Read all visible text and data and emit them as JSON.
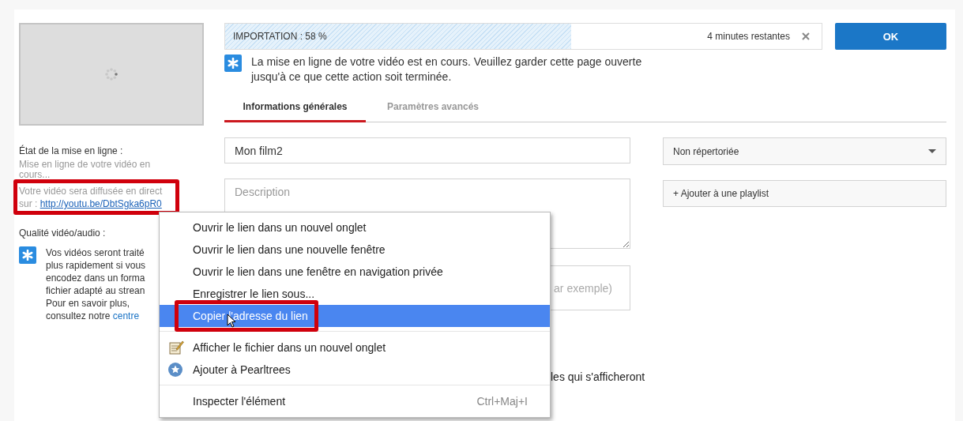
{
  "thumbnail": {
    "kind": "loading"
  },
  "status": {
    "heading": "État de la mise en ligne :",
    "text": "Mise en ligne de votre vidéo en cours...",
    "live_text": "Votre vidéo sera diffusée en direct",
    "link_prefix": "sur :",
    "link": "http://youtu.be/DbtSgka6pR0",
    "highlighted": true
  },
  "quality": {
    "heading": "Qualité vidéo/audio :",
    "lines": [
      "Vos vidéos seront traité",
      "plus rapidement si vous",
      "encodez dans un forma",
      "fichier adapté au strean",
      "Pour en savoir plus,"
    ],
    "last_line": "consultez notre",
    "link": "centre"
  },
  "upload": {
    "label": "IMPORTATION : 58 %",
    "level": 0.58,
    "remaining": "4 minutes restantes"
  },
  "ok_button": "OK",
  "notice": "La mise en ligne de votre vidéo est en cours. Veuillez garder cette page ouverte jusqu'à ce que cette action soit terminée.",
  "tabs": [
    {
      "label": "Informations générales",
      "selected": true
    },
    {
      "label": "Paramètres avancés",
      "selected": false
    }
  ],
  "form": {
    "title": {
      "value": "Mon film2"
    },
    "description": {
      "placeholder": "Description"
    },
    "tags": {
      "placeholder": "ar exemple)"
    },
    "note": "les qui s'afficheront"
  },
  "privacy": {
    "value": "Non répertoriée"
  },
  "playlist_button": "+ Ajouter à une playlist",
  "context_menu": [
    {
      "kind": "item",
      "label": "Ouvrir le lien dans un nouvel onglet",
      "selected": false
    },
    {
      "kind": "item",
      "label": "Ouvrir le lien dans une nouvelle fenêtre",
      "selected": false
    },
    {
      "kind": "item",
      "label": "Ouvrir le lien dans une fenêtre en navigation privée",
      "selected": false
    },
    {
      "kind": "item",
      "label": "Enregistrer le lien sous...",
      "selected": false
    },
    {
      "kind": "item",
      "label": "Copier l'adresse du lien",
      "selected": true,
      "highlighted": true
    },
    {
      "kind": "separator"
    },
    {
      "kind": "file",
      "label": "Afficher le fichier dans un nouvel onglet",
      "selected": false
    },
    {
      "kind": "pearltrees",
      "label": "Ajouter à Pearltrees",
      "selected": false
    },
    {
      "kind": "separator"
    },
    {
      "kind": "item",
      "label": "Inspecter l'élément",
      "shortcut": "Ctrl+Maj+I",
      "selected": false
    }
  ]
}
